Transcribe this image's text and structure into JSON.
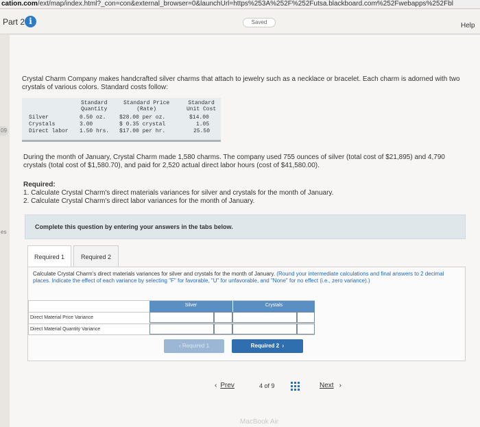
{
  "browser": {
    "url_domain": "cation.com",
    "url_rest": "/ext/map/index.html?_con=con&external_browser=0&launchUrl=https%253A%252F%252Futsa.blackboard.com%252Fwebapps%252Fbl"
  },
  "header": {
    "part_label": "Part 2",
    "info_glyph": "i",
    "saved_label": "Saved",
    "help_label": "Help"
  },
  "side_tabs": {
    "upper": "09",
    "lower": "es"
  },
  "problem": {
    "intro": "Crystal Charm Company makes handcrafted silver charms that attach to jewelry such as a necklace or bracelet. Each charm is adorned with two crystals of various colors. Standard costs follow:",
    "table": {
      "headers": {
        "qty": "Standard\nQuantity",
        "price": "Standard Price\n(Rate)",
        "unit_cost": "Standard\nUnit Cost"
      },
      "rows": [
        {
          "label": "Silver",
          "qty": "0.50 oz.",
          "price": "$28.00 per oz.",
          "unit_cost": "$14.00"
        },
        {
          "label": "Crystals",
          "qty": "3.00",
          "price": "$ 0.35 crystal",
          "unit_cost": "1.05"
        },
        {
          "label": "Direct labor",
          "qty": "1.50 hrs.",
          "price": "$17.00 per hr.",
          "unit_cost": "25.50"
        }
      ]
    },
    "paragraph": "During the month of January, Crystal Charm made 1,580 charms. The company used 755 ounces of silver (total cost of $21,895) and 4,790 crystals (total cost of $1,580.70), and paid for 2,520 actual direct labor hours (cost of $41,580.00).",
    "required_head": "Required:",
    "required_1": "1. Calculate Crystal Charm's direct materials variances for silver and crystals for the month of January.",
    "required_2": "2. Calculate Crystal Charm's direct labor variances for the month of January."
  },
  "complete_box": "Complete this question by entering your answers in the tabs below.",
  "tabs": [
    {
      "label": "Required 1",
      "active": true
    },
    {
      "label": "Required 2",
      "active": false
    }
  ],
  "panel": {
    "instructions_plain": "Calculate Crystal Charm's direct materials variances for silver and crystals for the month of January.",
    "instructions_blue": " (Round your intermediate calculations and final answers to 2 decimal places. Indicate the effect of each variance by selecting \"F\" for favorable, \"U\" for unfavorable, and \"None\" for no effect (i.e., zero variance).)",
    "grid": {
      "columns": [
        "Silver",
        "Crystals"
      ],
      "rows": [
        "Direct Material Price Variance",
        "Direct Material Quantity Variance"
      ]
    },
    "prev_button": "Required 1",
    "next_button": "Required 2"
  },
  "pager": {
    "prev": "Prev",
    "page_text": "4 of 9",
    "next": "Next"
  },
  "footer_watermark": "MacBook Air",
  "colors": {
    "accent": "#2f6fb0",
    "grid_header": "#5a8fc4",
    "info": "#2e7bc4"
  }
}
